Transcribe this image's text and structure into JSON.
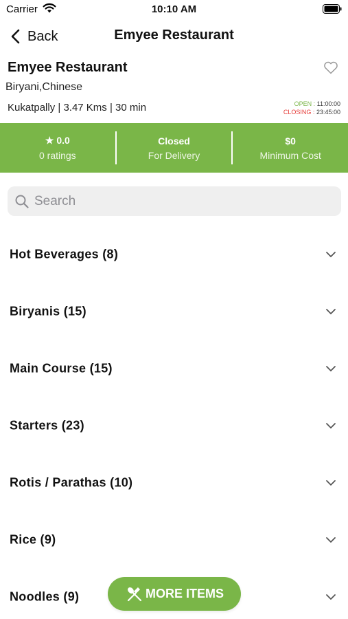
{
  "status_bar": {
    "carrier": "Carrier",
    "time": "10:10 AM"
  },
  "nav": {
    "back_label": "Back",
    "title": "Emyee Restaurant"
  },
  "restaurant": {
    "name": "Emyee Restaurant",
    "cuisine": "Biryani,Chinese",
    "location": "Kukatpally | 3.47 Kms | 30 min",
    "open_label": "OPEN :",
    "open_time": "11:00:00",
    "closing_label": "CLOSING :",
    "closing_time": "23:45:00"
  },
  "info_bar": {
    "rating": "★ 0.0",
    "ratings_count": "0 ratings",
    "status": "Closed",
    "status_sub": "For Delivery",
    "min_cost": "$0",
    "min_cost_label": "Minimum Cost"
  },
  "search": {
    "placeholder": "Search"
  },
  "categories": [
    {
      "label": "Hot Beverages (8)"
    },
    {
      "label": "Biryanis (15)"
    },
    {
      "label": "Main Course (15)"
    },
    {
      "label": "Starters (23)"
    },
    {
      "label": "Rotis / Parathas (10)"
    },
    {
      "label": "Rice (9)"
    },
    {
      "label": "Noodles (9)"
    }
  ],
  "more_button": {
    "label": "MORE ITEMS"
  },
  "colors": {
    "accent": "#7ab648",
    "open": "#7ab648",
    "closing": "#e53935"
  }
}
